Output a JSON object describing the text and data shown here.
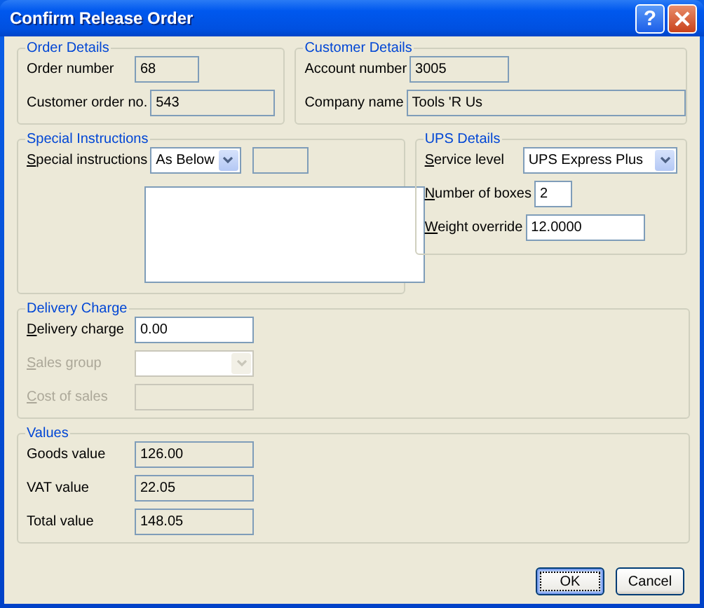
{
  "window": {
    "title": "Confirm Release Order",
    "help_button": "?"
  },
  "order_details": {
    "title": "Order Details",
    "rows": [
      {
        "label": "Order number",
        "value": "68"
      },
      {
        "label": "Customer order no.",
        "value": "543"
      }
    ]
  },
  "customer_details": {
    "title": "Customer Details",
    "rows": [
      {
        "label": "Account number",
        "value": "3005"
      },
      {
        "label": "Company name",
        "value": "Tools 'R Us"
      }
    ]
  },
  "special_instructions": {
    "title": "Special Instructions",
    "label": "Special instructions",
    "access_key": true,
    "select_value": "As Below"
  },
  "ups_details": {
    "title": "UPS Details",
    "rows": [
      {
        "label": "Service level",
        "access_key": true,
        "kind": "select",
        "value": "UPS Express Plus"
      },
      {
        "label": "Number of boxes",
        "access_key": true,
        "kind": "input",
        "value": "2"
      },
      {
        "label": "Weight override",
        "access_key": true,
        "kind": "input",
        "value": "12.0000"
      }
    ]
  },
  "delivery_charge": {
    "title": "Delivery Charge",
    "rows": [
      {
        "label": "Delivery charge",
        "access_key": true,
        "kind": "input",
        "value": "0.00",
        "disabled": false
      },
      {
        "label": "Sales group",
        "access_key": true,
        "kind": "select",
        "disabled": true
      },
      {
        "label": "Cost of sales",
        "access_key": true,
        "kind": "input",
        "disabled": true
      }
    ]
  },
  "values": {
    "title": "Values",
    "rows": [
      {
        "label": "Goods value",
        "value": "126.00"
      },
      {
        "label": "VAT value",
        "value": "22.05"
      },
      {
        "label": "Total value",
        "value": "148.05"
      }
    ]
  },
  "buttons": [
    {
      "label": "OK",
      "default": true
    },
    {
      "label": "Cancel",
      "default": false
    }
  ]
}
